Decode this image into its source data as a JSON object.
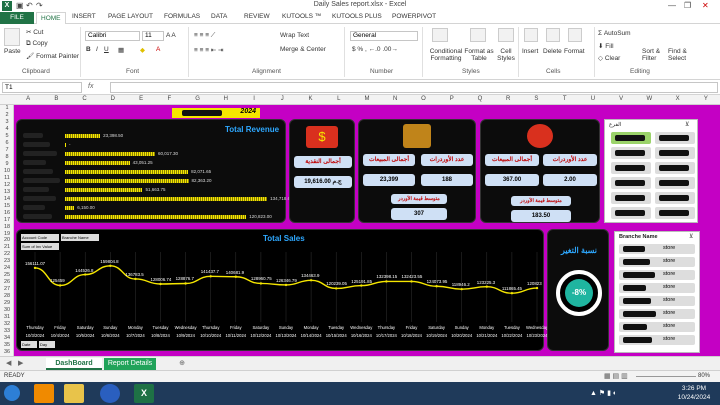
{
  "window": {
    "title": "Daily Sales report.xlsx - Excel",
    "logo": "X"
  },
  "tabs": [
    "FILE",
    "HOME",
    "INSERT",
    "PAGE LAYOUT",
    "FORMULAS",
    "DATA",
    "REVIEW",
    "KUTOOLS ™",
    "KUTOOLS PLUS",
    "POWERPIVOT"
  ],
  "ribbon": {
    "paste": "Paste",
    "cut": "Cut",
    "copy": "Copy",
    "format_painter": "Format Painter",
    "clipboard": "Clipboard",
    "font_name": "Calibri",
    "font_size": "11",
    "font_group": "Font",
    "wrap_text": "Wrap Text",
    "merge_center": "Merge & Center",
    "alignment": "Alignment",
    "number_format": "General",
    "number": "Number",
    "cond_format": "Conditional Formatting",
    "format_table": "Format as Table",
    "cell_styles": "Cell Styles",
    "styles": "Styles",
    "insert": "Insert",
    "delete": "Delete",
    "format": "Format",
    "cells": "Cells",
    "autosum": "AutoSum",
    "fill": "Fill",
    "clear": "Clear",
    "sort_filter": "Sort & Filter",
    "find_select": "Find & Select",
    "editing": "Editing"
  },
  "name_box": "T1",
  "fx": "fx",
  "columns": [
    "A",
    "B",
    "C",
    "D",
    "E",
    "F",
    "G",
    "H",
    "I",
    "J",
    "K",
    "L",
    "M",
    "N",
    "O",
    "P",
    "Q",
    "R",
    "S",
    "T",
    "U",
    "V",
    "W",
    "X",
    "Y"
  ],
  "rows": [
    "1",
    "2",
    "3",
    "4",
    "5",
    "6",
    "7",
    "8",
    "9",
    "10",
    "11",
    "12",
    "13",
    "14",
    "15",
    "16",
    "17",
    "18",
    "19",
    "20",
    "21",
    "22",
    "23",
    "24",
    "25",
    "26",
    "27",
    "28",
    "29",
    "30",
    "31",
    "32",
    "33",
    "34",
    "35",
    "36"
  ],
  "dashboard": {
    "header_date": "2024",
    "total_revenue": {
      "title": "Total Revenue",
      "bars": [
        {
          "value": 23398.5,
          "label": "23,398.50"
        },
        {
          "value": 0,
          "label": "-"
        },
        {
          "value": 60017.3,
          "label": "60,017.30"
        },
        {
          "value": 43051.25,
          "label": "43,051.25"
        },
        {
          "value": 82071.65,
          "label": "82,071.65"
        },
        {
          "value": 82363.2,
          "label": "82,363.20"
        },
        {
          "value": 51663.75,
          "label": "51,663.75"
        },
        {
          "value": 134718.64,
          "label": "134,718.64"
        },
        {
          "value": 6150,
          "label": "6,150.00"
        },
        {
          "value": 120823,
          "label": "120,823.00"
        }
      ]
    },
    "kpi_cash": {
      "label": "أجمالى النقدية",
      "value": "19,616.00 ج.م"
    },
    "kpi_group1": {
      "sales_label": "أجمالى المبيعات",
      "orders_label": "عدد الأوردرات",
      "sales": "23,399",
      "orders": "188",
      "avg_label": "متوسط قيمة الأوردر",
      "avg": "307"
    },
    "kpi_group2": {
      "sales_label": "أجمالى المبيعات",
      "orders_label": "عدد الأوردرات",
      "sales": "367.00",
      "orders": "2.00",
      "avg_label": "متوسط قيمة الأوردر",
      "avg": "183.50"
    },
    "slicer_branch": {
      "title": "الفرع"
    },
    "total_sales": {
      "title": "Total Sales",
      "filter1": "Account Code",
      "filter2": "Branche Name",
      "filter3": "Sum of Inv Value",
      "footer1": "Date",
      "footer2": "Day"
    },
    "change": {
      "label": "نسبة التغير",
      "value": "-8%"
    },
    "branch_list": {
      "title": "Branche Name",
      "items": [
        "store",
        "store",
        "store",
        "store",
        "store",
        "store",
        "store",
        "store"
      ]
    }
  },
  "chart_data": {
    "type": "line",
    "title": "Total Sales",
    "x": [
      "10/3/2024",
      "10/4/2024",
      "10/5/2024",
      "10/6/2024",
      "10/7/2024",
      "10/8/2024",
      "10/9/2024",
      "10/10/2024",
      "10/11/2024",
      "10/12/2024",
      "10/13/2024",
      "10/14/2024",
      "10/15/2024",
      "10/16/2024",
      "10/17/2024",
      "10/18/2024",
      "10/19/2024",
      "10/20/2024",
      "10/21/2024",
      "10/22/2024",
      "10/23/2024"
    ],
    "days": [
      "Thursday",
      "Friday",
      "Saturday",
      "Sunday",
      "Monday",
      "Tuesday",
      "Wednesday",
      "Thursday",
      "Friday",
      "Saturday",
      "Sunday",
      "Monday",
      "Tuesday",
      "Wednesday",
      "Thursday",
      "Friday",
      "Saturday",
      "Sunday",
      "Monday",
      "Tuesday",
      "Wednesday"
    ],
    "series": [
      {
        "values": [
          156111.07,
          125459,
          144526.8,
          159804.8,
          136783.5,
          128006.74,
          128876.7,
          141437.7,
          140681.9,
          128960.75,
          126346.79,
          134463.9,
          120239.05,
          125191.85,
          132398.15,
          132423.55,
          124073.95,
          118946.2,
          123225.3,
          111865.45,
          120823
        ]
      }
    ],
    "point_labels": [
      "156111.07",
      "125459",
      "144526.8",
      "159804.8",
      "136783.5",
      "128006.74",
      "128876.7",
      "141437.7",
      "140681.9",
      "128960.75",
      "126346.79",
      "134463.9",
      "120239.05",
      "125191.85",
      "132398.15",
      "132423.55",
      "124073.95",
      "118946.2",
      "123225.3",
      "111865.45",
      "120823"
    ]
  },
  "sheet_tabs": [
    "DashBoard",
    "Report Details"
  ],
  "status": {
    "ready": "READY",
    "zoom": "80%"
  },
  "taskbar": {
    "time": "3:26 PM",
    "date": "10/24/2024"
  },
  "colors": {
    "dashboard_bg": "#c400c4",
    "panel": "#0c0c0c",
    "title_blue": "#2ea8ff",
    "bar_yellow": "#f5e600",
    "kpi_bg": "#cfe0f5",
    "kpi_label": "#c00000",
    "change_ring": "#1fb5a0"
  }
}
